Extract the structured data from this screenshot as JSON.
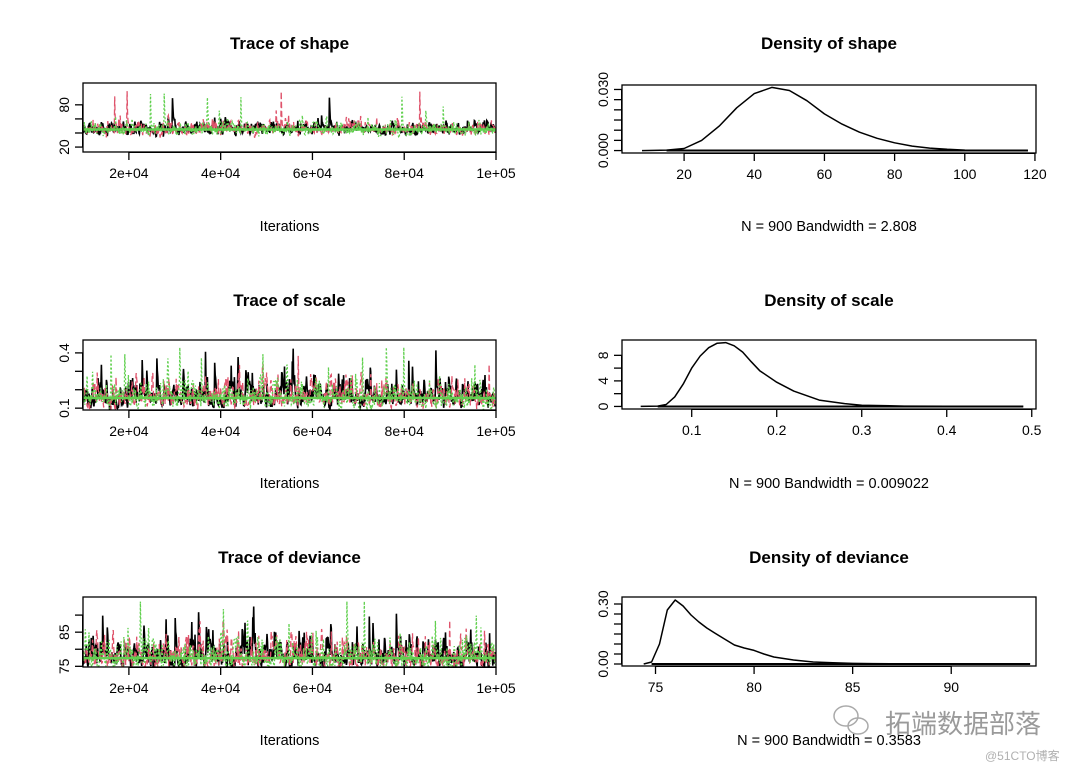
{
  "colors": {
    "chain1": "#000000",
    "chain2": "#DF536B",
    "chain3": "#61D04F",
    "mean_line": "#61D04F",
    "axis": "#000000"
  },
  "watermark": {
    "brand": "拓端数据部落",
    "site": "@51CTO博客",
    "icon": "wechat-icon"
  },
  "chart_data": [
    {
      "type": "line",
      "title": "Trace of shape",
      "xlabel": "Iterations",
      "ylabel": "",
      "xlim": [
        10000,
        100000
      ],
      "ylim": [
        13,
        111
      ],
      "xticks": [
        20000,
        40000,
        60000,
        80000,
        100000
      ],
      "xtick_labels": [
        "2e+04",
        "4e+04",
        "6e+04",
        "8e+04",
        "1e+05"
      ],
      "yticks": [
        20,
        40,
        60,
        80
      ],
      "ytick_labels": [
        "20",
        "",
        "",
        "80"
      ],
      "chains": 3,
      "approx_mean": 45,
      "approx_min": 15,
      "approx_max": 105
    },
    {
      "type": "line",
      "title": "Density of shape",
      "xlabel": "N = 900   Bandwidth = 2.808",
      "ylabel": "",
      "xlim": [
        2.3,
        120.3
      ],
      "ylim": [
        -0.0012,
        0.0322
      ],
      "xticks": [
        20,
        40,
        60,
        80,
        100,
        120
      ],
      "xtick_labels": [
        "20",
        "40",
        "60",
        "80",
        "100",
        "120"
      ],
      "yticks": [
        0,
        0.005,
        0.01,
        0.015,
        0.02,
        0.025,
        0.03
      ],
      "ytick_labels": [
        "0.000",
        "",
        "",
        "",
        "",
        "",
        "0.030"
      ],
      "x": [
        8,
        15,
        20,
        25,
        30,
        35,
        40,
        45,
        50,
        55,
        60,
        65,
        70,
        75,
        80,
        85,
        90,
        95,
        100,
        110,
        118
      ],
      "y": [
        0,
        0.0002,
        0.001,
        0.005,
        0.012,
        0.021,
        0.028,
        0.031,
        0.0295,
        0.0245,
        0.018,
        0.013,
        0.009,
        0.006,
        0.0038,
        0.0022,
        0.0012,
        0.0006,
        0.0002,
        5e-05,
        0
      ]
    },
    {
      "type": "line",
      "title": "Trace of scale",
      "xlabel": "Iterations",
      "ylabel": "",
      "xlim": [
        10000,
        100000
      ],
      "ylim": [
        0.09,
        0.47
      ],
      "xticks": [
        20000,
        40000,
        60000,
        80000,
        100000
      ],
      "xtick_labels": [
        "2e+04",
        "4e+04",
        "6e+04",
        "8e+04",
        "1e+05"
      ],
      "yticks": [
        0.1,
        0.2,
        0.3,
        0.4
      ],
      "ytick_labels": [
        "0.1",
        "",
        "",
        "0.4"
      ],
      "chains": 3,
      "approx_mean": 0.155,
      "approx_min": 0.08,
      "approx_max": 0.43
    },
    {
      "type": "line",
      "title": "Density of scale",
      "xlabel": "N = 900   Bandwidth = 0.009022",
      "ylabel": "",
      "xlim": [
        0.018,
        0.505
      ],
      "ylim": [
        -0.4,
        10.4
      ],
      "xticks": [
        0.1,
        0.2,
        0.3,
        0.4,
        0.5
      ],
      "xtick_labels": [
        "0.1",
        "0.2",
        "0.3",
        "0.4",
        "0.5"
      ],
      "yticks": [
        0,
        2,
        4,
        6,
        8
      ],
      "ytick_labels": [
        "0",
        "",
        "4",
        "",
        "8"
      ],
      "x": [
        0.04,
        0.06,
        0.07,
        0.08,
        0.09,
        0.1,
        0.11,
        0.12,
        0.13,
        0.14,
        0.15,
        0.16,
        0.17,
        0.18,
        0.2,
        0.22,
        0.25,
        0.28,
        0.3,
        0.35,
        0.4,
        0.45,
        0.49
      ],
      "y": [
        0,
        0.05,
        0.3,
        1.5,
        3.5,
        6,
        7.9,
        9.2,
        9.9,
        10,
        9.5,
        8.5,
        7,
        5.6,
        3.8,
        2.4,
        1,
        0.45,
        0.2,
        0.06,
        0.03,
        0.01,
        0
      ]
    },
    {
      "type": "line",
      "title": "Trace of deviance",
      "xlabel": "Iterations",
      "ylabel": "",
      "xlim": [
        10000,
        100000
      ],
      "ylim": [
        74.8,
        95.3
      ],
      "xticks": [
        20000,
        40000,
        60000,
        80000,
        100000
      ],
      "xtick_labels": [
        "2e+04",
        "4e+04",
        "6e+04",
        "8e+04",
        "1e+05"
      ],
      "yticks": [
        75,
        80,
        85,
        90
      ],
      "ytick_labels": [
        "75",
        "",
        "85",
        ""
      ],
      "chains": 3,
      "approx_mean": 77.4,
      "approx_min": 75,
      "approx_max": 94
    },
    {
      "type": "line",
      "title": "Density of deviance",
      "xlabel": "N = 900   Bandwidth = 0.3583",
      "ylabel": "",
      "xlim": [
        73.3,
        94.3
      ],
      "ylim": [
        -0.01,
        0.335
      ],
      "xticks": [
        75,
        80,
        85,
        90
      ],
      "xtick_labels": [
        "75",
        "80",
        "85",
        "90"
      ],
      "yticks": [
        0,
        0.05,
        0.1,
        0.15,
        0.2,
        0.25,
        0.3
      ],
      "ytick_labels": [
        "0.00",
        "",
        "",
        "",
        "",
        "",
        "0.30"
      ],
      "x": [
        74.4,
        74.8,
        75.2,
        75.6,
        76,
        76.4,
        76.8,
        77.2,
        77.6,
        78,
        78.5,
        79,
        79.5,
        80,
        80.5,
        81,
        82,
        83,
        84,
        85,
        86,
        87,
        90,
        94
      ],
      "y": [
        0,
        0.01,
        0.1,
        0.27,
        0.32,
        0.29,
        0.245,
        0.21,
        0.18,
        0.155,
        0.125,
        0.095,
        0.08,
        0.068,
        0.05,
        0.035,
        0.02,
        0.01,
        0.006,
        0.003,
        0.002,
        0.001,
        0.0005,
        0
      ]
    }
  ]
}
